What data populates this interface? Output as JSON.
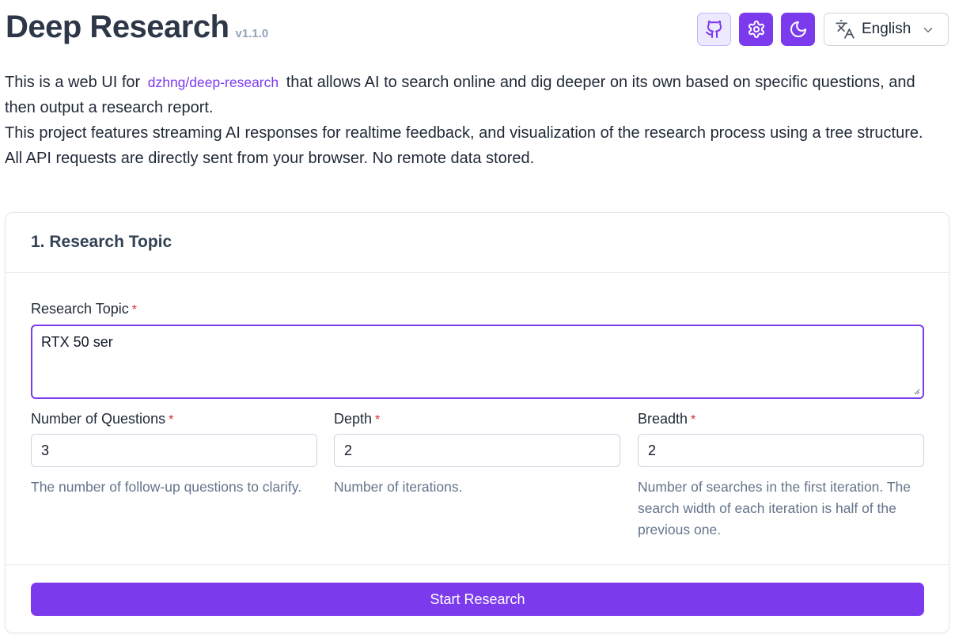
{
  "header": {
    "title": "Deep Research",
    "version": "v1.1.0",
    "language": "English",
    "icons": [
      "github-icon",
      "gear-icon",
      "moon-icon",
      "translate-icon",
      "chevron-down-icon"
    ]
  },
  "intro": {
    "line1_pre": "This is a web UI for",
    "link": "dzhng/deep-research",
    "line1_post": "that allows AI to search online and dig deeper on its own based on specific questions, and then output a research report.",
    "line2": "This project features streaming AI responses for realtime feedback, and visualization of the research process using a tree structure.",
    "line3": "All API requests are directly sent from your browser. No remote data stored."
  },
  "card": {
    "title": "1. Research Topic",
    "required_mark": "*",
    "topic": {
      "label": "Research Topic",
      "value": "RTX 50 ser"
    },
    "questions": {
      "label": "Number of Questions",
      "value": "3",
      "help": "The number of follow-up questions to clarify."
    },
    "depth": {
      "label": "Depth",
      "value": "2",
      "help": "Number of iterations."
    },
    "breadth": {
      "label": "Breadth",
      "value": "2",
      "help": "Number of searches in the first iteration. The search width of each iteration is half of the previous one."
    },
    "start_label": "Start Research"
  },
  "colors": {
    "accent": "#7c3aed",
    "accent_light": "#ede9fe",
    "required": "#dc2626",
    "muted": "#64748b"
  }
}
